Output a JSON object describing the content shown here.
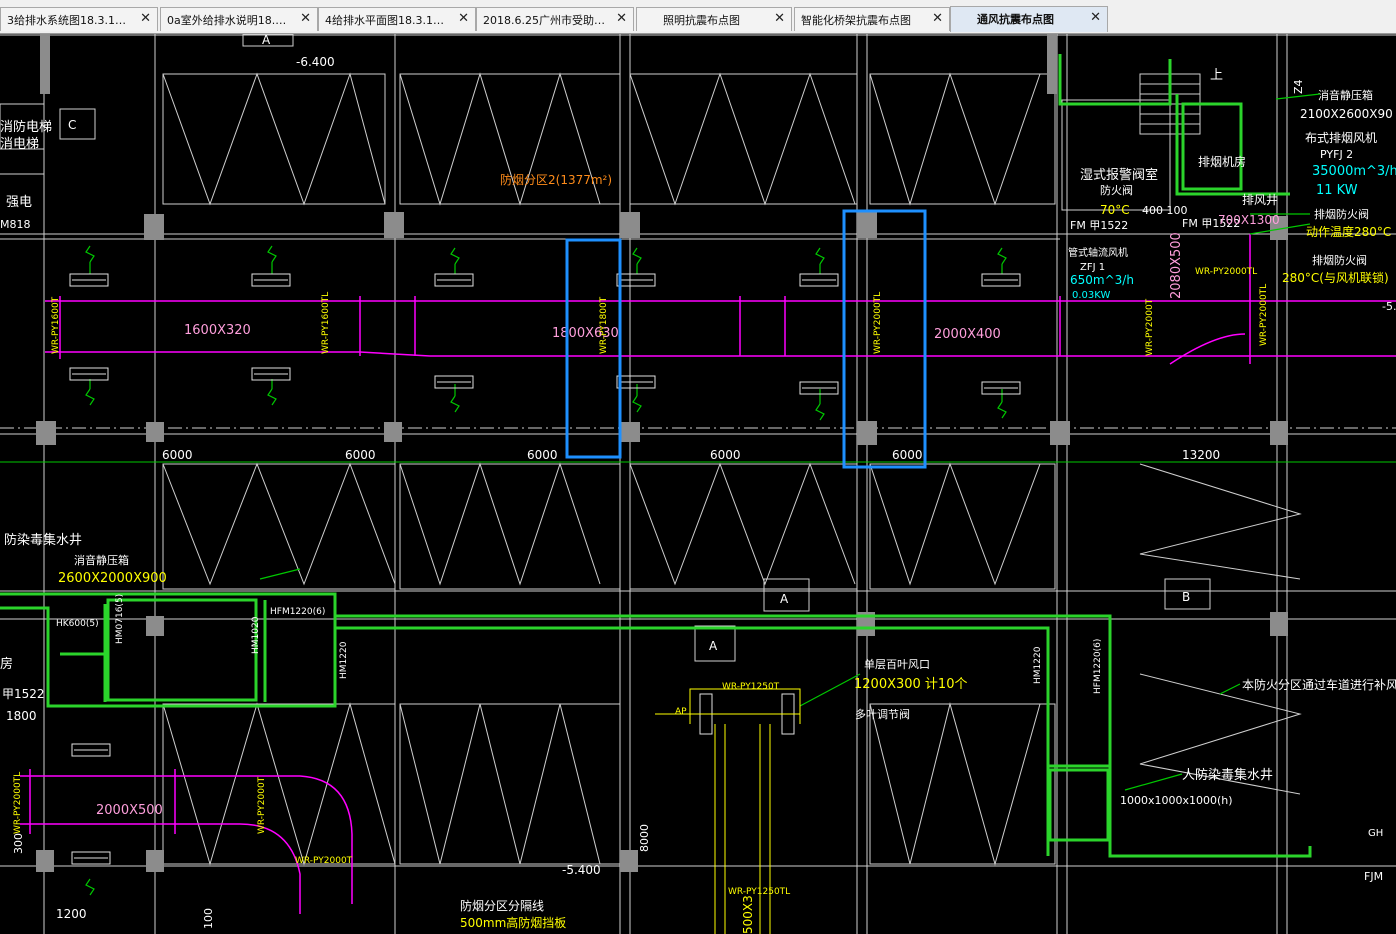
{
  "tabs": [
    {
      "label": "3给排水系统图18.3.1…",
      "active": false
    },
    {
      "label": "0a室外给排水说明18.…",
      "active": false
    },
    {
      "label": "4给排水平面图18.3.1…",
      "active": false
    },
    {
      "label": "2018.6.25广州市受助…",
      "active": false
    },
    {
      "label": "照明抗震布点图",
      "active": false
    },
    {
      "label": "智能化桥架抗震布点图",
      "active": false
    },
    {
      "label": "通风抗震布点图",
      "active": true
    }
  ],
  "tab_close_glyph": "✕",
  "colors": {
    "background": "#000000",
    "grid": "#d8d8d8",
    "duct": "#ff00ff",
    "wall": "#2bd42b",
    "highlight": "#1e90ff",
    "dim_green": "#00c800",
    "label_yellow": "#ffff00",
    "label_white": "#ffffff",
    "label_pink": "#ff9fdc",
    "label_orange": "#ff8c1a",
    "label_cyan": "#00ffff"
  },
  "drawing": {
    "dimensions": {
      "bay_1": "6000",
      "bay_2": "6000",
      "bay_3": "6000",
      "bay_4": "6000",
      "bay_5": "6000",
      "bay_6": "13200",
      "bottom_left": "1200",
      "level_top": "-6.400",
      "level_bottom": "-5.400",
      "left_1800": "1800"
    },
    "duct_sizes": {
      "d1": "1600X320",
      "d2": "1800X630",
      "d3": "2000X400",
      "d4": "2000X500",
      "d5_vertical": "2080X500"
    },
    "duct_tags": {
      "t1": "WR-PY1600T",
      "t2": "WR-PY1600TL",
      "t3": "WR-PY1800T",
      "t4": "WR-PY2000TL",
      "t5": "WR-PY2000T",
      "t6": "WR-PY2000TL",
      "t7": "WR-PY1250TL",
      "t8": "WR-PY1250T",
      "t9": "WR-PY2000T",
      "t10": "WR-PY2000T",
      "t11": "WR-PY2000TL",
      "t12": "WR-PY1250TL",
      "t13": "WR-PY2000TL"
    },
    "labels": {
      "smoke_zone": "防烟分区2(1377m²)",
      "fire_elevator": "消防电梯",
      "elevator2": "消电梯",
      "strong_elec": "强电",
      "door_code": "M818",
      "wet_alarm": "湿式报警阀室",
      "fire_valve": "防火阀",
      "fire_valve_temp": "70°C",
      "size_400_100": "400 100",
      "fm_a1": "FM 甲1522",
      "fm_a2": "FM 甲1522",
      "dim_700": "700X1300",
      "axial_fan": "轴式排烟风机",
      "pyfj": "PYFJ 2",
      "airflow": "35000m^3/h",
      "power": "11 KW",
      "exhaust_valve": "排烟防火阀",
      "action_temp": "动作温度280°C",
      "exhaust_shaft": "排风井",
      "pipe_fan": "管式轴流风机",
      "zfj": "ZFJ 1",
      "flow_650": "650m^3/h",
      "kw_small": "0.03KW",
      "temp_280": "280°C(与风机联锁)",
      "muffler_box": "消音静压箱",
      "muffler_size": "2100X2600X90",
      "cloth_exhaust": "布式排烟风机",
      "smoke_fan_room": "排烟机房",
      "up": "上",
      "zone_axis": "Z4",
      "anti_poison_well": "防染毒集水井",
      "muffler_box2": "消音静压箱",
      "muffler_size2": "2600X2000X900",
      "hk600": "HK600(5)",
      "hm0716": "HM0716(5)",
      "hm1020": "HM1020",
      "hfm1220": "HFM1220(6)",
      "hm1220": "HM1220",
      "room_house": "房",
      "a1522": "甲1522",
      "single_louver": "单层百叶风口",
      "louver_size": "1200X300 计10个",
      "multi_damper": "多叶调节阀",
      "compensate": "本防火分区通过车道进行补风",
      "anti_poison_well2": "人防染毒集水井",
      "well_size": "1000x1000x1000(h)",
      "smoke_zone_line": "防烟分区分隔线",
      "smoke_barrier": "500mm高防烟挡板",
      "hm1220_6": "HFM1220(6)",
      "hm_b": "HM1220",
      "a_mark": "A",
      "b_mark": "B",
      "c_mark": "C",
      "dim_8000": "8000",
      "dim_500x": "500X3",
      "dim_300": "300",
      "dim_100": "100",
      "fjm": "FJM",
      "gh": "GH",
      "minus5": "-5.",
      "ap": "AP"
    }
  }
}
